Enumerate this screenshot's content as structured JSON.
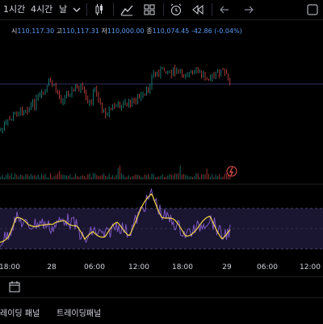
{
  "toolbar": {
    "intervals": [
      "1시간",
      "4시간",
      "날"
    ],
    "icons": [
      "chevron-down-icon",
      "candles-icon",
      "indicators-icon",
      "layout-icon",
      "alert-icon",
      "replay-icon",
      "undo-icon",
      "redo-icon",
      "fullscreen-icon"
    ]
  },
  "ohlc": {
    "open_label": "시",
    "open": "110,117.30",
    "high_label": "고",
    "high": "110,117.31",
    "low_label": "저",
    "low": "110,000.00",
    "close_label": "종",
    "close": "110,074.45",
    "change": "-42.86 (-0.04%)"
  },
  "xaxis": {
    "labels": [
      "18:00",
      "28",
      "06:00",
      "12:00",
      "18:00",
      "29",
      "06:00",
      "12:00"
    ]
  },
  "bottom_tabs": [
    "레이딩 패널",
    "트레이딩패널"
  ],
  "colors": {
    "up": "#26a69a",
    "down": "#ef5350",
    "rsi": "#7e57c2",
    "rsi_ma": "#f5d547",
    "accent": "#5b9cf6"
  }
}
